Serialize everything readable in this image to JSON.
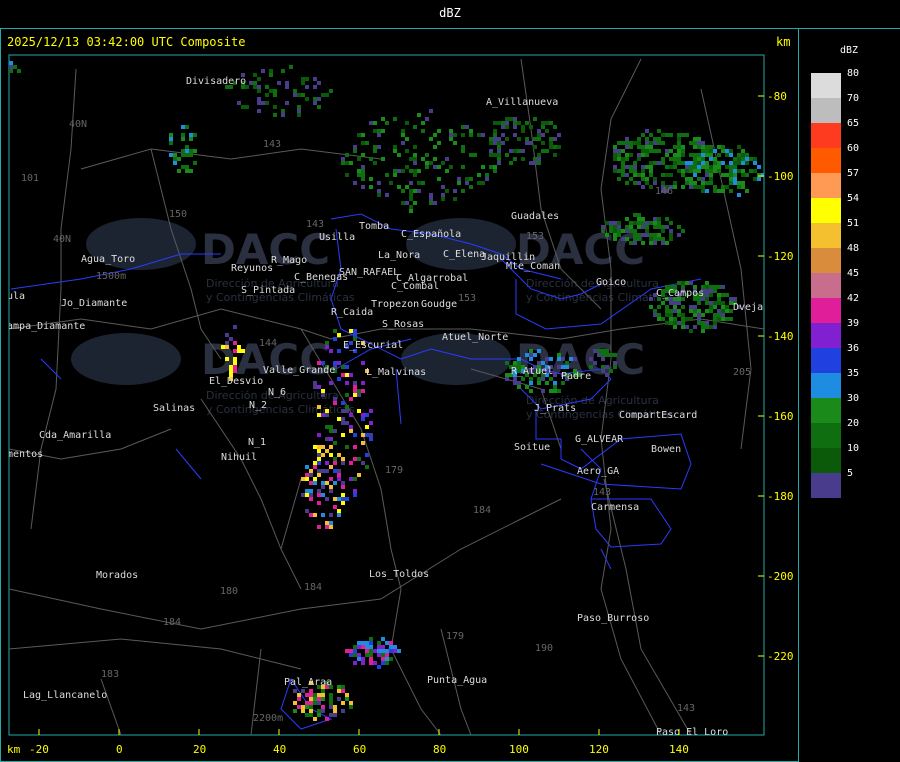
{
  "title": "dBZ",
  "header": {
    "datetime": "2025/12/13 03:42:00 UTC Composite",
    "unit": "km"
  },
  "legend": {
    "unit": "dBZ",
    "entries": [
      {
        "value": "80",
        "color": "#dcdcdc"
      },
      {
        "value": "70",
        "color": "#bdbdbd"
      },
      {
        "value": "65",
        "color": "#ff3b1f"
      },
      {
        "value": "60",
        "color": "#ff5a00"
      },
      {
        "value": "57",
        "color": "#ff9a55"
      },
      {
        "value": "54",
        "color": "#ffff00"
      },
      {
        "value": "51",
        "color": "#f5c030"
      },
      {
        "value": "48",
        "color": "#d98c3c"
      },
      {
        "value": "45",
        "color": "#c86e8c"
      },
      {
        "value": "42",
        "color": "#e01e9a"
      },
      {
        "value": "39",
        "color": "#8020d0"
      },
      {
        "value": "36",
        "color": "#2040e0"
      },
      {
        "value": "35",
        "color": "#1e8ce0"
      },
      {
        "value": "30",
        "color": "#1a8a1a"
      },
      {
        "value": "20",
        "color": "#0f6e0f"
      },
      {
        "value": "10",
        "color": "#0a5a0a"
      },
      {
        "value": "5",
        "color": "#4a3c8c"
      }
    ]
  },
  "axes": {
    "y_ticks": [
      "-80",
      "-100",
      "-120",
      "-140",
      "-160",
      "-180",
      "-200",
      "-220"
    ],
    "x_unit": "km",
    "x_ticks": [
      "-20",
      "0",
      "20",
      "40",
      "60",
      "80",
      "100",
      "120",
      "140"
    ]
  },
  "watermark": {
    "text": "DACC",
    "sub1": "Dirección de Agricultura",
    "sub2": "y Contingencias Climáticas"
  },
  "places": [
    {
      "name": "Divisadero"
    },
    {
      "name": "A_Villanueva"
    },
    {
      "name": "Guadales"
    },
    {
      "name": "Usilla"
    },
    {
      "name": "Tomba"
    },
    {
      "name": "C_Española"
    },
    {
      "name": "La_Nora"
    },
    {
      "name": "C_Elena"
    },
    {
      "name": "Jaquillin"
    },
    {
      "name": "Mte_Coman"
    },
    {
      "name": "Goico"
    },
    {
      "name": "C_Campos"
    },
    {
      "name": "Dveja"
    },
    {
      "name": "Agua_Toro"
    },
    {
      "name": "Reyunos"
    },
    {
      "name": "R_Mago"
    },
    {
      "name": "C_Benegas"
    },
    {
      "name": "SAN_RAFAEL"
    },
    {
      "name": "C_Algarrobal"
    },
    {
      "name": "C_Combal"
    },
    {
      "name": "S_Pintada"
    },
    {
      "name": "Tropezon"
    },
    {
      "name": "Goudge"
    },
    {
      "name": "R_Caida"
    },
    {
      "name": "S_Rosas"
    },
    {
      "name": "Atuel_Norte"
    },
    {
      "name": "Pampa_Diamante"
    },
    {
      "name": "Jo_Diamante"
    },
    {
      "name": "E_Escurial"
    },
    {
      "name": "L_Malvinas"
    },
    {
      "name": "Valle_Grande"
    },
    {
      "name": "El_Desvio"
    },
    {
      "name": "R_Atuel"
    },
    {
      "name": "Padre"
    },
    {
      "name": "Salinas"
    },
    {
      "name": "N_2"
    },
    {
      "name": "N_6"
    },
    {
      "name": "J_Prats"
    },
    {
      "name": "CompartEscard"
    },
    {
      "name": "Cda_Amarilla"
    },
    {
      "name": "N_1"
    },
    {
      "name": "Nihuil"
    },
    {
      "name": "G_ALVEAR"
    },
    {
      "name": "Bowen"
    },
    {
      "name": "Soitue"
    },
    {
      "name": "Aero_GA"
    },
    {
      "name": "Carmensa"
    },
    {
      "name": "Morados"
    },
    {
      "name": "Los_Toldos"
    },
    {
      "name": "Paso_Burroso"
    },
    {
      "name": "Punta_Agua"
    },
    {
      "name": "Lag_Llancanelo"
    },
    {
      "name": "Paso_El_Loro"
    },
    {
      "name": "Pal_Araa"
    },
    {
      "name": "amentos"
    },
    {
      "name": "aula"
    }
  ],
  "road_labels": [
    {
      "name": "143"
    },
    {
      "name": "40N"
    },
    {
      "name": "101"
    },
    {
      "name": "150"
    },
    {
      "name": "40N"
    },
    {
      "name": "143"
    },
    {
      "name": "153"
    },
    {
      "name": "146"
    },
    {
      "name": "144"
    },
    {
      "name": "179"
    },
    {
      "name": "184"
    },
    {
      "name": "180"
    },
    {
      "name": "184"
    },
    {
      "name": "184"
    },
    {
      "name": "183"
    },
    {
      "name": "179"
    },
    {
      "name": "190"
    },
    {
      "name": "143"
    },
    {
      "name": "205"
    },
    {
      "name": "153"
    },
    {
      "name": "143"
    },
    {
      "name": "1500m"
    },
    {
      "name": "2200m"
    }
  ]
}
